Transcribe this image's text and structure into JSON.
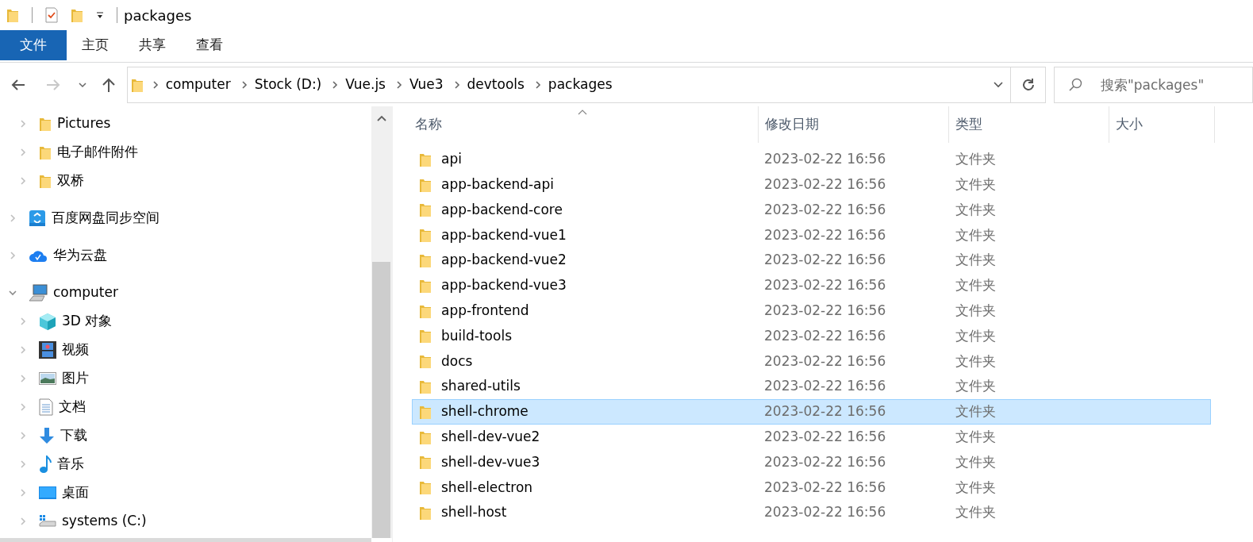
{
  "title_bar": {
    "title": "packages"
  },
  "ribbon": {
    "tabs": [
      {
        "label": "文件",
        "kind": "file_menu"
      },
      {
        "label": "主页",
        "kind": "tab"
      },
      {
        "label": "共享",
        "kind": "tab"
      },
      {
        "label": "查看",
        "kind": "tab"
      }
    ]
  },
  "navigation": {
    "back": {
      "disabled": false
    },
    "forward": {
      "disabled": true
    },
    "address": {
      "crumbs": [
        "computer",
        "Stock (D:)",
        "Vue.js",
        "Vue3",
        "devtools",
        "packages"
      ]
    },
    "search": {
      "placeholder": "搜索\"packages\""
    }
  },
  "nav_pane": {
    "clipped_group_children": [
      {
        "label": "Pictures",
        "kind": "folder",
        "selected": false
      },
      {
        "label": "电子邮件附件",
        "kind": "folder",
        "selected": false
      },
      {
        "label": "双桥",
        "kind": "folder",
        "selected": false
      }
    ],
    "items": [
      {
        "label": "百度网盘同步空间",
        "kind": "baidu",
        "expanded": false,
        "selected": false
      },
      {
        "label": "华为云盘",
        "kind": "cloud",
        "expanded": false,
        "selected": false
      },
      {
        "label": "computer",
        "kind": "computer",
        "expanded": true,
        "selected": false,
        "children": [
          {
            "label": "3D 对象",
            "kind": "cube",
            "selected": false
          },
          {
            "label": "视频",
            "kind": "video",
            "selected": false
          },
          {
            "label": "图片",
            "kind": "pictures",
            "selected": false
          },
          {
            "label": "文档",
            "kind": "document",
            "selected": false
          },
          {
            "label": "下载",
            "kind": "download",
            "selected": false
          },
          {
            "label": "音乐",
            "kind": "music",
            "selected": false
          },
          {
            "label": "桌面",
            "kind": "desktop",
            "selected": false
          },
          {
            "label": "systems (C:)",
            "kind": "drive",
            "selected": false
          }
        ]
      }
    ]
  },
  "file_list": {
    "columns": [
      "名称",
      "修改日期",
      "类型",
      "大小"
    ],
    "rows": [
      {
        "name": "api",
        "modified": "2023-02-22 16:56",
        "type": "文件夹",
        "selected": false
      },
      {
        "name": "app-backend-api",
        "modified": "2023-02-22 16:56",
        "type": "文件夹",
        "selected": false
      },
      {
        "name": "app-backend-core",
        "modified": "2023-02-22 16:56",
        "type": "文件夹",
        "selected": false
      },
      {
        "name": "app-backend-vue1",
        "modified": "2023-02-22 16:56",
        "type": "文件夹",
        "selected": false
      },
      {
        "name": "app-backend-vue2",
        "modified": "2023-02-22 16:56",
        "type": "文件夹",
        "selected": false
      },
      {
        "name": "app-backend-vue3",
        "modified": "2023-02-22 16:56",
        "type": "文件夹",
        "selected": false
      },
      {
        "name": "app-frontend",
        "modified": "2023-02-22 16:56",
        "type": "文件夹",
        "selected": false
      },
      {
        "name": "build-tools",
        "modified": "2023-02-22 16:56",
        "type": "文件夹",
        "selected": false
      },
      {
        "name": "docs",
        "modified": "2023-02-22 16:56",
        "type": "文件夹",
        "selected": false
      },
      {
        "name": "shared-utils",
        "modified": "2023-02-22 16:56",
        "type": "文件夹",
        "selected": false
      },
      {
        "name": "shell-chrome",
        "modified": "2023-02-22 16:56",
        "type": "文件夹",
        "selected": true
      },
      {
        "name": "shell-dev-vue2",
        "modified": "2023-02-22 16:56",
        "type": "文件夹",
        "selected": false
      },
      {
        "name": "shell-dev-vue3",
        "modified": "2023-02-22 16:56",
        "type": "文件夹",
        "selected": false
      },
      {
        "name": "shell-electron",
        "modified": "2023-02-22 16:56",
        "type": "文件夹",
        "selected": false
      },
      {
        "name": "shell-host",
        "modified": "2023-02-22 16:56",
        "type": "文件夹",
        "selected": false
      }
    ]
  }
}
